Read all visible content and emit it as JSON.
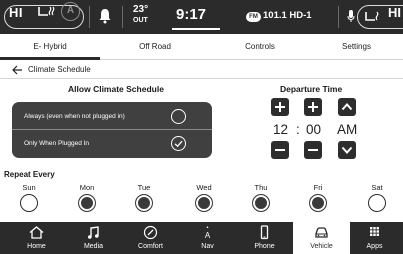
{
  "status_bar": {
    "left_hvac": "HI",
    "temp": "23°",
    "temp_caption": "OUT",
    "time": "9:17",
    "radio_band": "FM",
    "station": "101.1 HD-1",
    "right_hvac": "HI",
    "auto_badge": "A"
  },
  "tabs": [
    {
      "label": "E- Hybrid"
    },
    {
      "label": "Off Road"
    },
    {
      "label": "Controls"
    },
    {
      "label": "Settings"
    }
  ],
  "breadcrumb": {
    "title": "Climate Schedule"
  },
  "schedule": {
    "heading": "Allow Climate Schedule",
    "options": [
      {
        "label": "Always (even when not plugged in)",
        "selected": false
      },
      {
        "label": "Only When Plugged In",
        "selected": true
      }
    ]
  },
  "departure": {
    "heading": "Departure Time",
    "hour": "12",
    "separator": ":",
    "minute": "00",
    "period": "AM"
  },
  "repeat": {
    "label": "Repeat Every",
    "days": [
      {
        "name": "Sun",
        "selected": false
      },
      {
        "name": "Mon",
        "selected": true
      },
      {
        "name": "Tue",
        "selected": true
      },
      {
        "name": "Wed",
        "selected": true
      },
      {
        "name": "Thu",
        "selected": true
      },
      {
        "name": "Fri",
        "selected": true
      },
      {
        "name": "Sat",
        "selected": false
      }
    ]
  },
  "bottom_nav": [
    {
      "label": "Home",
      "icon": "home-icon",
      "active": false
    },
    {
      "label": "Media",
      "icon": "music-note-icon",
      "active": false
    },
    {
      "label": "Comfort",
      "icon": "comfort-icon",
      "active": false
    },
    {
      "label": "Nav",
      "icon": "compass-icon",
      "active": false
    },
    {
      "label": "Phone",
      "icon": "phone-icon",
      "active": false
    },
    {
      "label": "Vehicle",
      "icon": "car-icon",
      "active": true
    },
    {
      "label": "Apps",
      "icon": "apps-grid-icon",
      "active": false
    }
  ],
  "colors": {
    "bar_dark": "#2b2b2b",
    "panel_dark": "#404040",
    "active_tab": "#ffffff"
  }
}
